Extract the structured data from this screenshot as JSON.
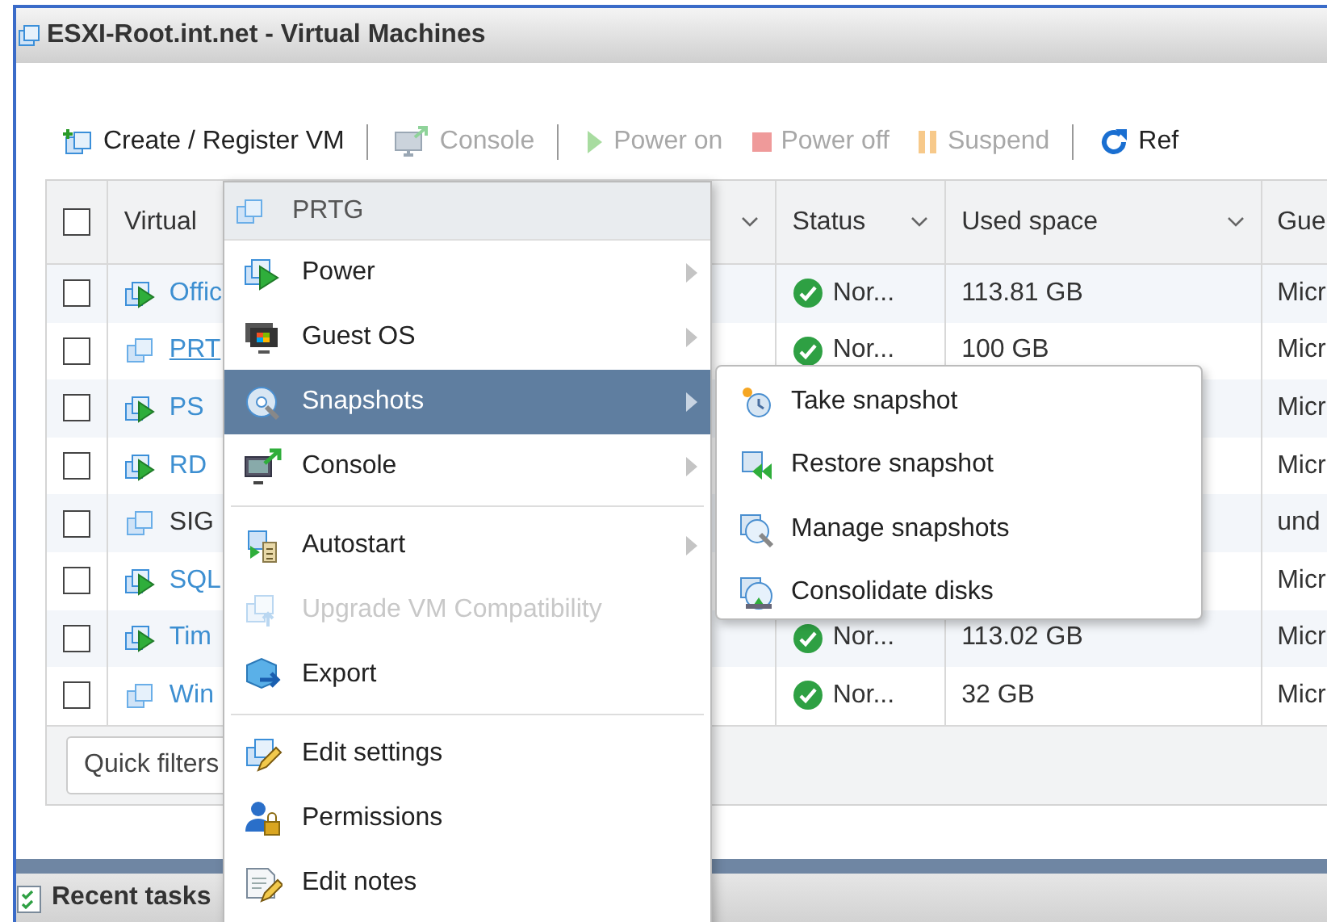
{
  "window": {
    "title": "ESXI-Root.int.net - Virtual Machines"
  },
  "toolbar": [
    {
      "label": "Create / Register VM",
      "disabled": false
    },
    {
      "label": "Console",
      "disabled": true
    },
    {
      "label": "Power on",
      "disabled": true
    },
    {
      "label": "Power off",
      "disabled": true
    },
    {
      "label": "Suspend",
      "disabled": true
    },
    {
      "label": "Ref",
      "disabled": false
    }
  ],
  "table": {
    "select_all": {
      "checked": false
    },
    "columns": [
      {
        "label": "Virtual"
      },
      {
        "label": "Status"
      },
      {
        "label": "Used space"
      },
      {
        "label": "Gue"
      }
    ],
    "rows": [
      {
        "checked": false,
        "name": "Offic",
        "powered_on": true,
        "link": true,
        "hovered": false,
        "status": "Nor...",
        "used_space": "113.81 GB",
        "guest": "Micr"
      },
      {
        "checked": false,
        "name": "PRT",
        "powered_on": false,
        "link": true,
        "hovered": true,
        "status": "Nor...",
        "used_space": "100 GB",
        "guest": "Micr"
      },
      {
        "checked": false,
        "name": "PS",
        "powered_on": true,
        "link": true,
        "hovered": false,
        "guest": "Micr"
      },
      {
        "checked": false,
        "name": "RD",
        "powered_on": true,
        "link": true,
        "hovered": false,
        "guest": "Micr"
      },
      {
        "checked": false,
        "name": "SIG",
        "powered_on": false,
        "link": false,
        "hovered": false,
        "guest": "und"
      },
      {
        "checked": false,
        "name": "SQL",
        "powered_on": true,
        "link": true,
        "hovered": false,
        "guest": "Micr"
      },
      {
        "checked": false,
        "name": "Tim",
        "powered_on": true,
        "link": true,
        "hovered": false,
        "status": "Nor...",
        "used_space": "113.02 GB",
        "guest": "Micr"
      },
      {
        "checked": false,
        "name": "Win",
        "powered_on": false,
        "link": true,
        "hovered": false,
        "status": "Nor...",
        "used_space": "32 GB",
        "guest": "Micr"
      }
    ],
    "quick_filters": "Quick filters"
  },
  "recent_tasks": {
    "title": "Recent tasks"
  },
  "context_menu": {
    "title": "PRTG",
    "items": [
      {
        "kind": "item",
        "label": "Power",
        "submenu": true,
        "selected": false,
        "disabled": false
      },
      {
        "kind": "item",
        "label": "Guest OS",
        "submenu": true,
        "selected": false,
        "disabled": false
      },
      {
        "kind": "item",
        "label": "Snapshots",
        "submenu": true,
        "selected": true,
        "disabled": false
      },
      {
        "kind": "item",
        "label": "Console",
        "submenu": true,
        "selected": false,
        "disabled": false
      },
      {
        "kind": "divider"
      },
      {
        "kind": "item",
        "label": "Autostart",
        "submenu": true,
        "selected": false,
        "disabled": false
      },
      {
        "kind": "item",
        "label": "Upgrade VM Compatibility",
        "submenu": false,
        "selected": false,
        "disabled": true
      },
      {
        "kind": "item",
        "label": "Export",
        "submenu": false,
        "selected": false,
        "disabled": false
      },
      {
        "kind": "divider"
      },
      {
        "kind": "item",
        "label": "Edit settings",
        "submenu": false,
        "selected": false,
        "disabled": false
      },
      {
        "kind": "item",
        "label": "Permissions",
        "submenu": false,
        "selected": false,
        "disabled": false
      },
      {
        "kind": "item",
        "label": "Edit notes",
        "submenu": false,
        "selected": false,
        "disabled": false
      }
    ]
  },
  "submenu": {
    "items": [
      {
        "label": "Take snapshot"
      },
      {
        "label": "Restore snapshot"
      },
      {
        "label": "Manage snapshots"
      },
      {
        "label": "Consolidate disks"
      }
    ]
  }
}
